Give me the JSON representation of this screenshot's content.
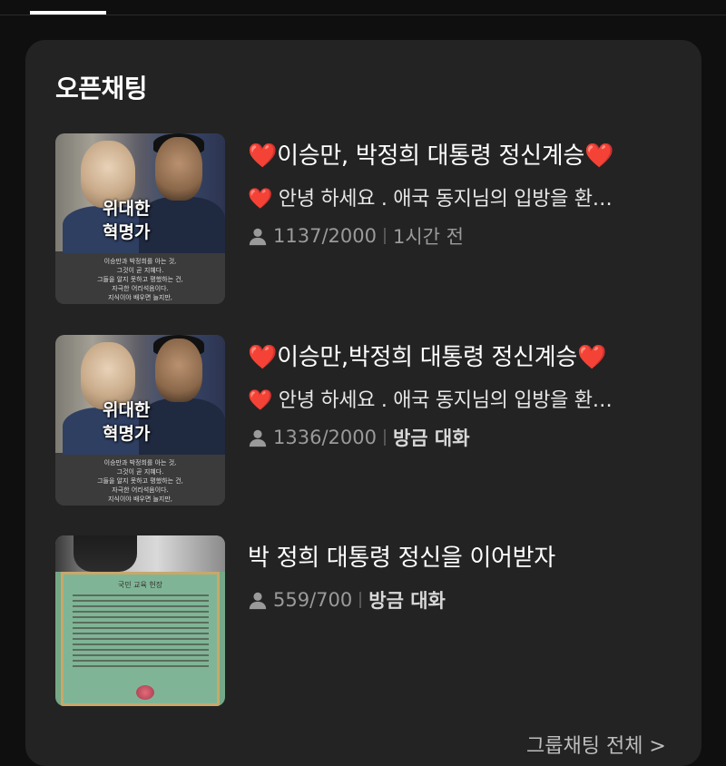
{
  "section_title": "오픈채팅",
  "rooms": [
    {
      "title": "❤️이승만, 박정희 대통령 정신계승❤️",
      "description": "❤️ 안녕 하세요 . 애국 동지님의 입방을 환…",
      "members": "1137/2000",
      "last_active": "1시간 전",
      "thumb_caption_1": "위대한",
      "thumb_caption_2": "혁명가",
      "thumb_text": [
        "이승만과 박정희를 아는 것,",
        "그것이 곧 지혜다.",
        "그들을 알지 못하고 평했하는 건,",
        "자극한 어리석음이다.",
        "지식이야 배우면 늘지만,"
      ]
    },
    {
      "title": "❤️이승만,박정희 대통령 정신계승❤️",
      "description": "❤️ 안녕 하세요 . 애국 동지님의 입방을 환…",
      "members": "1336/2000",
      "last_active": "방금 대화",
      "thumb_caption_1": "위대한",
      "thumb_caption_2": "혁명가",
      "thumb_text": [
        "이승만과 박정희를 아는 것,",
        "그것이 곧 지혜다.",
        "그들을 알지 못하고 평했하는 건,",
        "자극한 어리석음이다.",
        "지식이야 배우면 늘지만,"
      ]
    },
    {
      "title": "박 정희 대통령 정신을 이어받자",
      "members": "559/700",
      "last_active": "방금 대화",
      "thumb_doc_title": "국민 교육 헌장"
    }
  ],
  "more_link": "그룹채팅 전체 >",
  "colors": {
    "background": "#0f0f0f",
    "card": "#232323",
    "heart": "#ff4a73",
    "meta": "#9a9a9a"
  },
  "icons": {
    "members": "user-icon",
    "more": "chevron-right-icon"
  }
}
